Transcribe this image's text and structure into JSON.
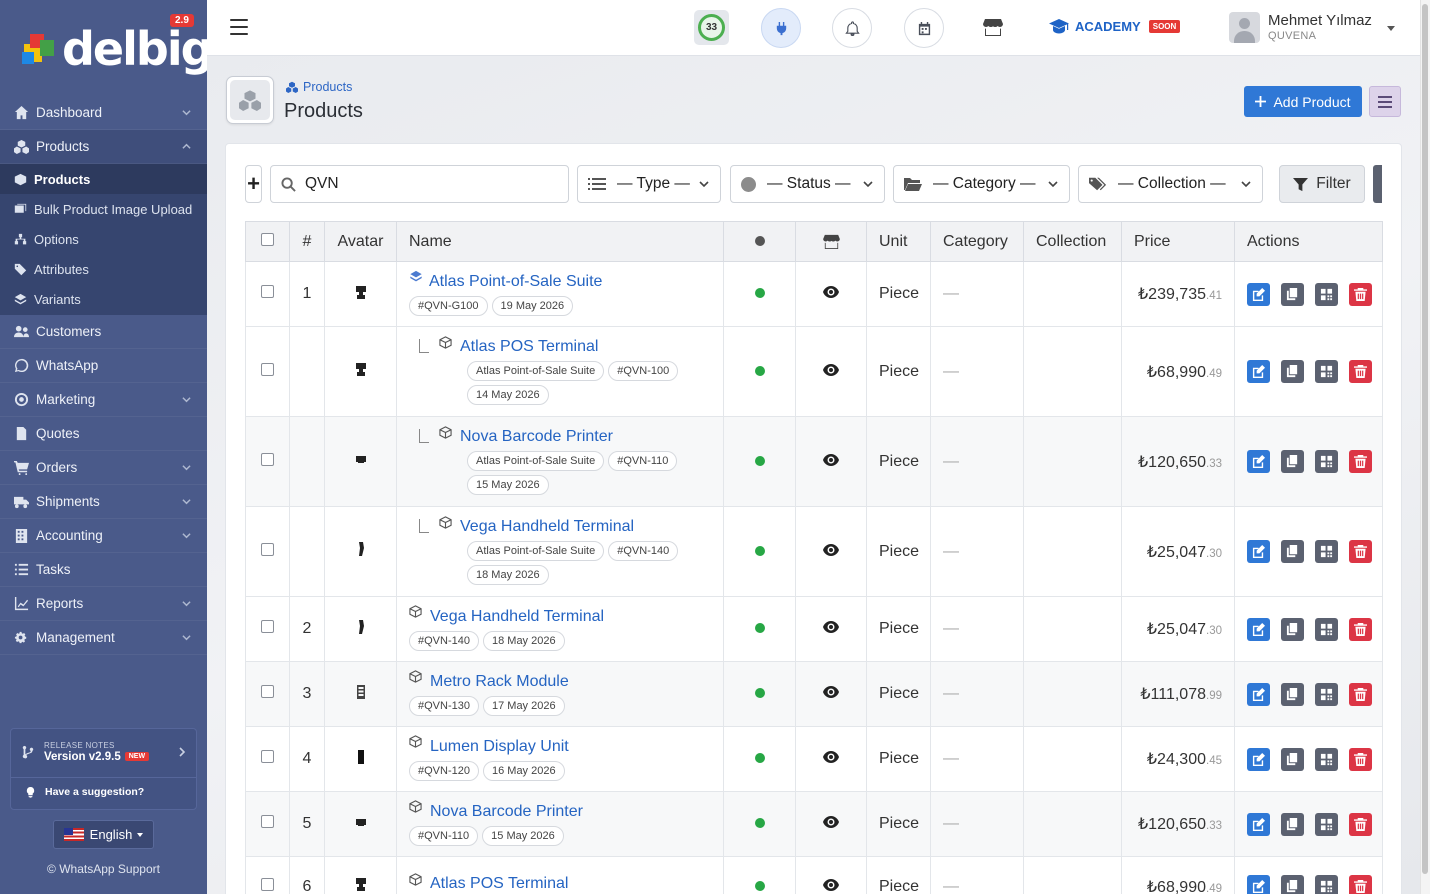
{
  "sidebar": {
    "logo_text": "delbig",
    "logo_badge": "2.9",
    "items": [
      {
        "label": "Dashboard",
        "icon": "home-icon"
      },
      {
        "label": "Products",
        "icon": "cubes-icon"
      },
      {
        "label": "Customers",
        "icon": "users-icon"
      },
      {
        "label": "WhatsApp",
        "icon": "whatsapp-icon"
      },
      {
        "label": "Marketing",
        "icon": "target-icon"
      },
      {
        "label": "Quotes",
        "icon": "file-icon"
      },
      {
        "label": "Orders",
        "icon": "cart-icon"
      },
      {
        "label": "Shipments",
        "icon": "truck-icon"
      },
      {
        "label": "Accounting",
        "icon": "building-icon"
      },
      {
        "label": "Tasks",
        "icon": "tasks-icon"
      },
      {
        "label": "Reports",
        "icon": "chart-icon"
      },
      {
        "label": "Management",
        "icon": "cogs-icon"
      }
    ],
    "sub_items": [
      {
        "label": "Products",
        "icon": "box-icon"
      },
      {
        "label": "Bulk Product Image Upload",
        "icon": "images-icon"
      },
      {
        "label": "Options",
        "icon": "sitemap-icon"
      },
      {
        "label": "Attributes",
        "icon": "tags-icon"
      },
      {
        "label": "Variants",
        "icon": "layers-icon"
      }
    ],
    "release": {
      "caption": "RELEASE NOTES",
      "version": "Version v2.9.5",
      "new_badge": "NEW",
      "suggestion": "Have a suggestion?"
    },
    "language": "English",
    "support": "© WhatsApp Support"
  },
  "topbar": {
    "count": "33",
    "academy": "ACADEMY",
    "soon": "SOON",
    "user_name": "Mehmet Yılmaz",
    "user_org": "QUVENA"
  },
  "page": {
    "breadcrumb": "Products",
    "title": "Products",
    "add_label": "Add Product"
  },
  "filters": {
    "search_value": "QVN",
    "type": "— Type —",
    "status": "— Status —",
    "category": "— Category —",
    "collection": "— Collection —",
    "filter_label": "Filter"
  },
  "table": {
    "headers": {
      "num": "#",
      "avatar": "Avatar",
      "name": "Name",
      "unit": "Unit",
      "category": "Category",
      "collection": "Collection",
      "price": "Price",
      "actions": "Actions"
    },
    "rows": [
      {
        "num": "1",
        "name": "Atlas Point-of-Sale Suite",
        "tags": [
          "#QVN-G100",
          "19 May 2026"
        ],
        "unit": "Piece",
        "category": "—",
        "price_main": "₺239,735",
        "price_dec": ".41"
      },
      {
        "num": "",
        "name": "Atlas POS Terminal",
        "tags": [
          "Atlas Point-of-Sale Suite",
          "#QVN-100",
          "14 May 2026"
        ],
        "unit": "Piece",
        "category": "—",
        "price_main": "₺68,990",
        "price_dec": ".49"
      },
      {
        "num": "",
        "name": "Nova Barcode Printer",
        "tags": [
          "Atlas Point-of-Sale Suite",
          "#QVN-110",
          "15 May 2026"
        ],
        "unit": "Piece",
        "category": "—",
        "price_main": "₺120,650",
        "price_dec": ".33"
      },
      {
        "num": "",
        "name": "Vega Handheld Terminal",
        "tags": [
          "Atlas Point-of-Sale Suite",
          "#QVN-140",
          "18 May 2026"
        ],
        "unit": "Piece",
        "category": "—",
        "price_main": "₺25,047",
        "price_dec": ".30"
      },
      {
        "num": "2",
        "name": "Vega Handheld Terminal",
        "tags": [
          "#QVN-140",
          "18 May 2026"
        ],
        "unit": "Piece",
        "category": "—",
        "price_main": "₺25,047",
        "price_dec": ".30"
      },
      {
        "num": "3",
        "name": "Metro Rack Module",
        "tags": [
          "#QVN-130",
          "17 May 2026"
        ],
        "unit": "Piece",
        "category": "—",
        "price_main": "₺111,078",
        "price_dec": ".99"
      },
      {
        "num": "4",
        "name": "Lumen Display Unit",
        "tags": [
          "#QVN-120",
          "16 May 2026"
        ],
        "unit": "Piece",
        "category": "—",
        "price_main": "₺24,300",
        "price_dec": ".45"
      },
      {
        "num": "5",
        "name": "Nova Barcode Printer",
        "tags": [
          "#QVN-110",
          "15 May 2026"
        ],
        "unit": "Piece",
        "category": "—",
        "price_main": "₺120,650",
        "price_dec": ".33"
      },
      {
        "num": "6",
        "name": "Atlas POS Terminal",
        "tags": [],
        "unit": "Piece",
        "category": "—",
        "price_main": "₺68,990",
        "price_dec": ".49"
      }
    ]
  },
  "colors": {
    "sidebar": "#4a5a8a",
    "primary": "#2f78d6",
    "danger": "#dc3545",
    "status_active": "#27a745"
  }
}
